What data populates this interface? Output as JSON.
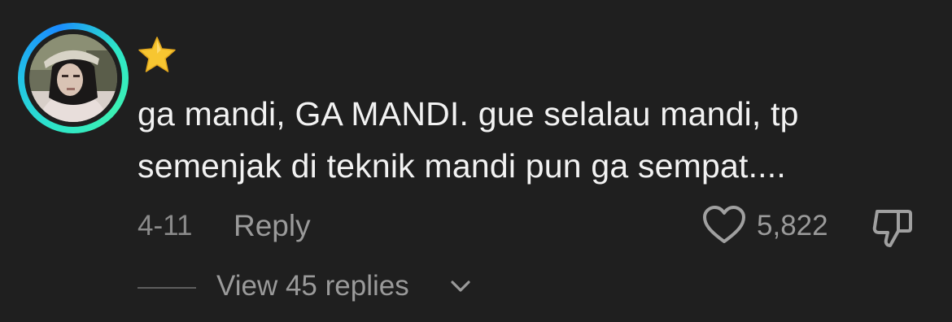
{
  "comment": {
    "badge_icon": "star-icon",
    "text_line1": "ga mandi, GA MANDI. gue selalau mandi, tp",
    "text_line2": "semenjak di teknik mandi pun ga sempat....",
    "date": "4-11",
    "reply_label": "Reply",
    "like_icon": "heart-icon",
    "like_count": "5,822",
    "dislike_icon": "thumbs-down-icon"
  },
  "replies": {
    "view_label": "View 45 replies",
    "icon": "chevron-down-icon"
  },
  "colors": {
    "background": "#1f1f1f",
    "text_primary": "#f2f2f2",
    "text_secondary": "#9a9a9a",
    "star": "#f7c631",
    "avatar_ring": "#2ee6c8"
  }
}
